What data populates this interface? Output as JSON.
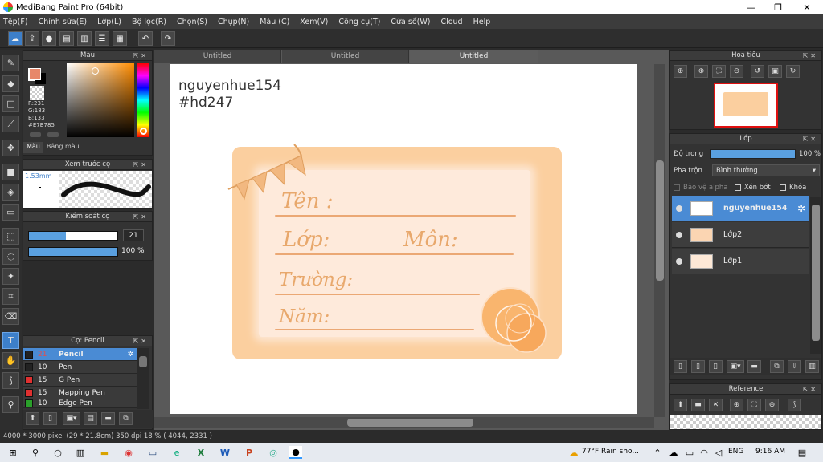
{
  "window": {
    "title": "MediBang Paint Pro (64bit)"
  },
  "menu": [
    "Tệp(F)",
    "Chỉnh sửa(E)",
    "Lớp(L)",
    "Bộ lọc(R)",
    "Chọn(S)",
    "Chụp(N)",
    "Màu (C)",
    "Xem(V)",
    "Công cụ(T)",
    "Cửa sổ(W)",
    "Cloud",
    "Help"
  ],
  "color_panel": {
    "title": "Màu",
    "r": "R:231",
    "g": "G:183",
    "b": "B:133",
    "hex": "#E7B785",
    "tabs": [
      "Màu",
      "Bảng màu"
    ],
    "fg": "#e7876a"
  },
  "brush_preview": {
    "title": "Xem trước cọ",
    "size": "1.53mm"
  },
  "brush_control": {
    "title": "Kiểm soát cọ",
    "size_value": "21",
    "opacity_value": "100 %",
    "size_fraction": 0.42,
    "opacity_fraction": 1.0
  },
  "brush_list": {
    "title": "Cọ: Pencil",
    "items": [
      {
        "size": "21",
        "name": "Pencil",
        "color": "#222222"
      },
      {
        "size": "10",
        "name": "Pen",
        "color": "#222222"
      },
      {
        "size": "15",
        "name": "G Pen",
        "color": "#e03030"
      },
      {
        "size": "15",
        "name": "Mapping Pen",
        "color": "#e03030"
      },
      {
        "size": "10",
        "name": "Edge Pen",
        "color": "#2aa02a"
      }
    ]
  },
  "tabs": [
    "Untitled",
    "Untitled",
    "Untitled"
  ],
  "canvas": {
    "watermark1": "nguyenhue154",
    "watermark2": "#hd247",
    "field1": "Tên :",
    "field2": "Lớp:",
    "field3": "Môn:",
    "field4": "Trường:",
    "field5": "Năm:"
  },
  "navigator": {
    "title": "Hoa tiêu"
  },
  "layer_panel": {
    "title": "Lớp",
    "opacity_label": "Độ trong",
    "opacity_value": "100 %",
    "blend_label": "Pha trộn",
    "blend_value": "Bình thường",
    "protect_alpha": "Bảo vệ alpha",
    "clip": "Xén bớt",
    "lock": "Khóa",
    "layers": [
      "nguyenhue154",
      "Lớp2",
      "Lớp1"
    ]
  },
  "reference": {
    "title": "Reference"
  },
  "status": "4000 * 3000 pixel   (29 * 21.8cm)   350 dpi   18 %   ( 4044, 2331 )",
  "taskbar": {
    "weather": "77°F  Rain sho...",
    "lang": "ENG",
    "time": "9:16 AM"
  }
}
